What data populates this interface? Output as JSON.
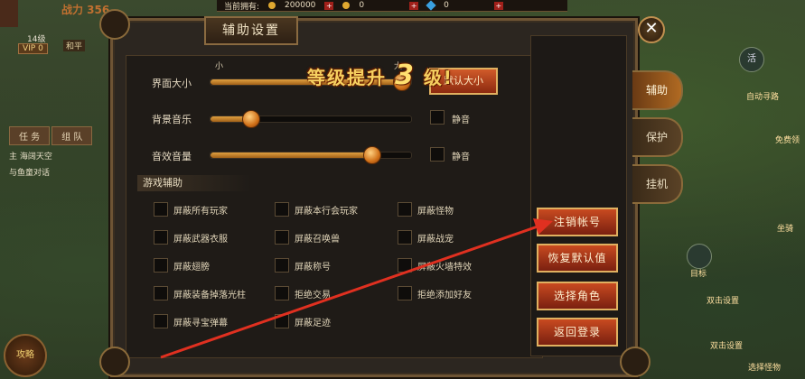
{
  "topbar": {
    "owned_label": "当前拥有:",
    "gold": "200000",
    "ingot": "0",
    "gem": "0",
    "plus": "+"
  },
  "hud": {
    "power_label": "战力 356",
    "level": "14级",
    "vip": "VIP 0",
    "mode": "和平",
    "task_tabs": [
      "任 务",
      "组 队"
    ],
    "task_lines": [
      "主  海阔天空",
      "与鱼童对话"
    ],
    "skill_button": "攻略",
    "right_labels": [
      "活",
      "自动寻路",
      "目标",
      "双击设置",
      "双击设置",
      "选择怪物",
      "坐骑",
      "免费领"
    ]
  },
  "dialog": {
    "title": "辅助设置",
    "close": "✕",
    "ui_size": {
      "label": "界面大小",
      "min_label": "小",
      "max_label": "大",
      "value": 0.95
    },
    "default_button": "默认大小",
    "bg_music": {
      "label": "背景音乐",
      "value": 0.2,
      "mute_label": "静音"
    },
    "sfx_volume": {
      "label": "音效音量",
      "value": 0.8,
      "mute_label": "静音"
    },
    "section_title": "游戏辅助",
    "checkboxes": [
      [
        "屏蔽所有玩家",
        "屏蔽本行会玩家",
        "屏蔽怪物"
      ],
      [
        "屏蔽武器衣服",
        "屏蔽召唤兽",
        "屏蔽战宠"
      ],
      [
        "屏蔽翅膀",
        "屏蔽称号",
        "屏蔽火墙特效"
      ],
      [
        "屏蔽装备掉落光柱",
        "拒绝交易",
        "拒绝添加好友"
      ],
      [
        "屏蔽寻宝弹幕",
        "屏蔽足迹"
      ]
    ],
    "actions": [
      "注销帐号",
      "恢复默认值",
      "选择角色",
      "返回登录"
    ],
    "side_tabs": [
      "辅助",
      "保护",
      "挂机"
    ],
    "levelup": {
      "prefix": "等级提升",
      "number": "3",
      "suffix": "级!"
    }
  },
  "colors": {
    "accent_red": "#c84a20",
    "gold_border": "#e0b060",
    "arrow": "#e03020"
  }
}
